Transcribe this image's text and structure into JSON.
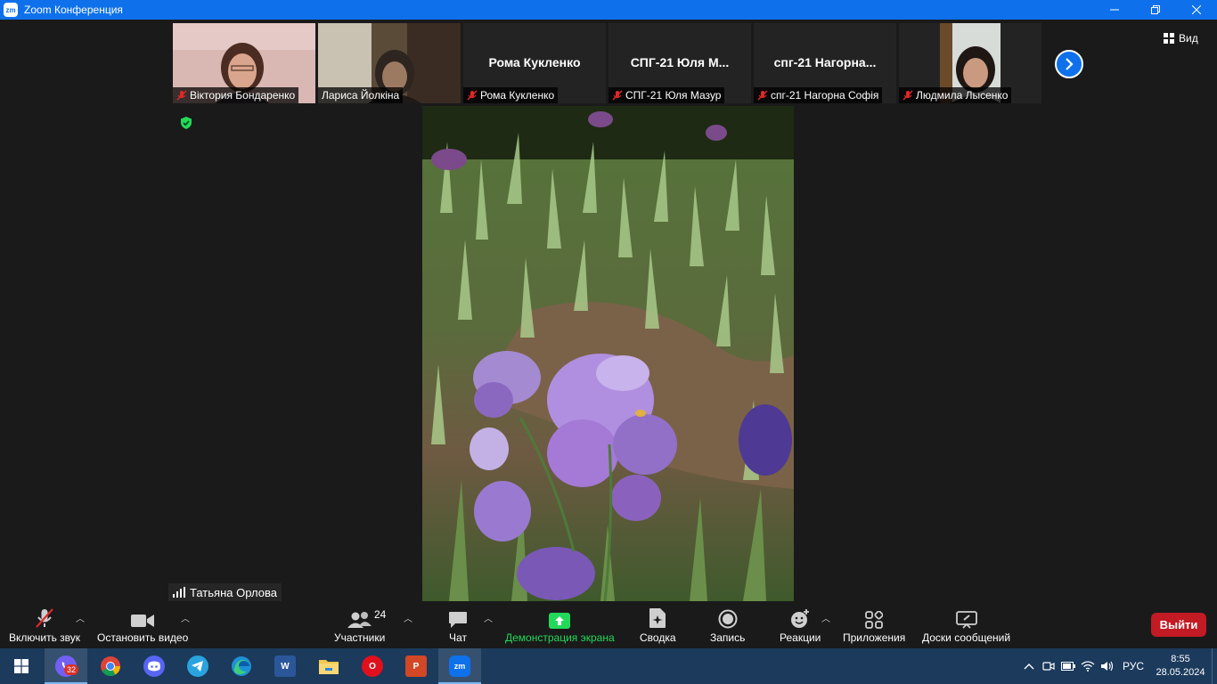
{
  "window": {
    "title": "Zoom Конференция",
    "logo_text": "zm"
  },
  "participants": [
    {
      "name": "Віктория Бондаренко",
      "muted": true,
      "has_video": true
    },
    {
      "name": "Лариса Йолкіна",
      "muted": false,
      "has_video": true
    },
    {
      "name": "Рома Кукленко",
      "display_name": "Рома Кукленко",
      "muted": true,
      "has_video": false
    },
    {
      "name": "СПГ-21 Юля Мазур",
      "display_name": "СПГ-21  Юля  М...",
      "muted": true,
      "has_video": false
    },
    {
      "name": "спг-21 Нагорна Софія",
      "display_name": "спг-21  Нагорна...",
      "muted": true,
      "has_video": false
    },
    {
      "name": "Людмила Лысенко",
      "muted": true,
      "has_video": true
    }
  ],
  "view_button": "Вид",
  "active_speaker": "Татьяна Орлова",
  "toolbar": {
    "mute_label": "Включить звук",
    "video_label": "Остановить видео",
    "participants_label": "Участники",
    "participants_count": "24",
    "chat_label": "Чат",
    "share_label": "Демонстрация экрана",
    "summary_label": "Сводка",
    "record_label": "Запись",
    "reactions_label": "Реакции",
    "apps_label": "Приложения",
    "whiteboards_label": "Доски сообщений",
    "leave_label": "Выйти"
  },
  "colors": {
    "accent": "#0e71eb",
    "share_green": "#23d959",
    "leave_red": "#c21b24",
    "mute_red": "#e02828"
  },
  "taskbar": {
    "apps": [
      "windows-start",
      "viber",
      "chrome",
      "discord",
      "telegram",
      "edge",
      "word",
      "file-explorer",
      "opera",
      "powerpoint",
      "zoom"
    ],
    "viber_badge": "32",
    "word_text": "W",
    "powerpoint_text": "P",
    "opera_text": "O",
    "zoom_text": "zm",
    "language": "РУС",
    "time": "8:55",
    "date": "28.05.2024"
  }
}
